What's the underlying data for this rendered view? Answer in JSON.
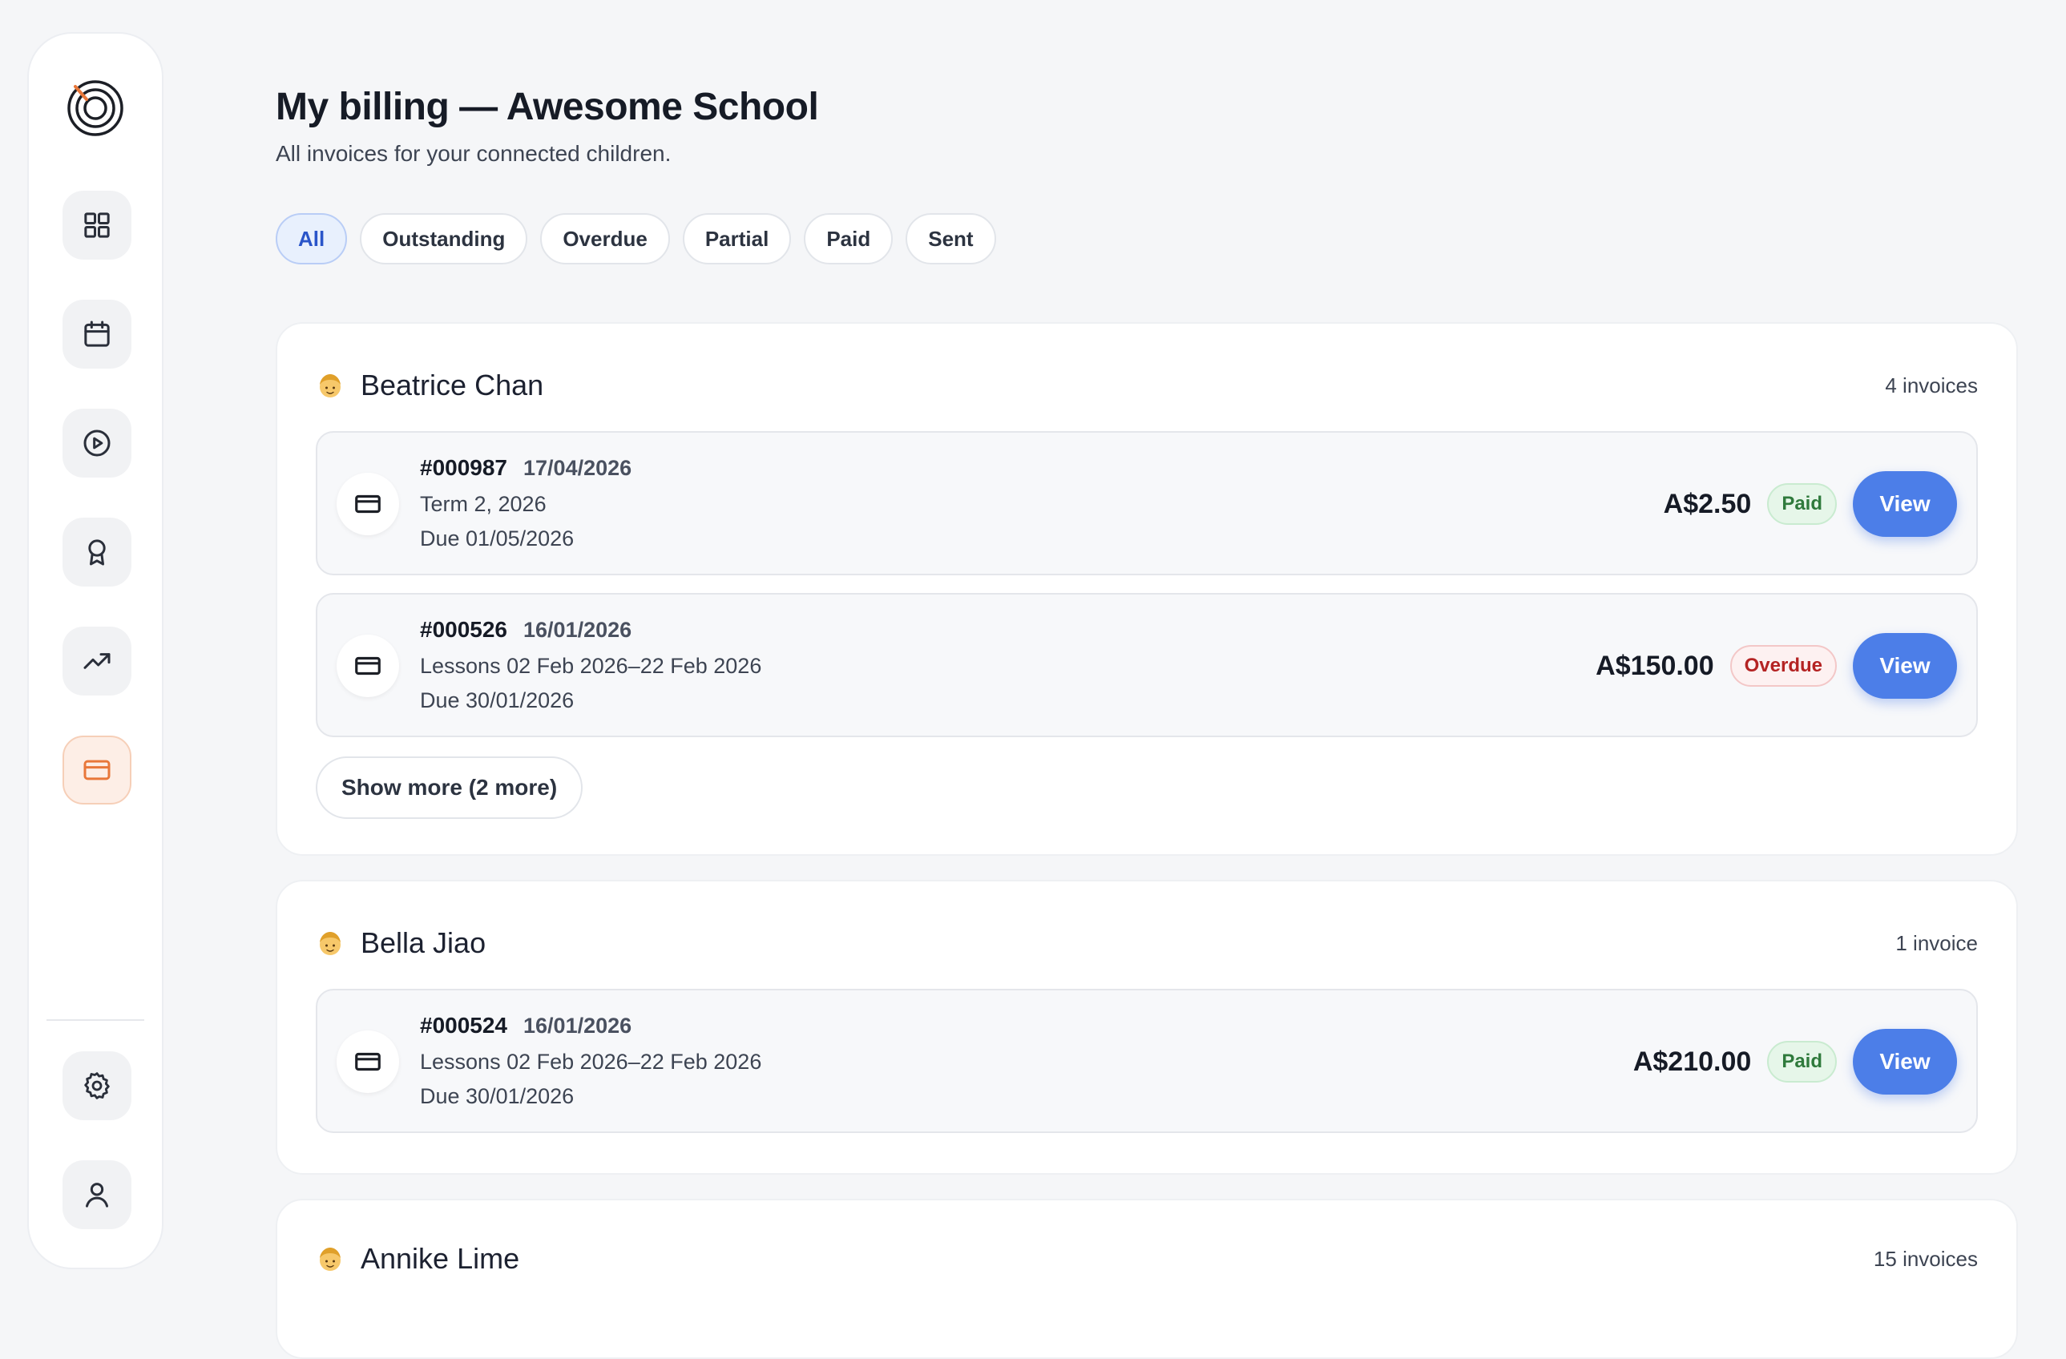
{
  "page": {
    "title": "My billing — Awesome School",
    "subtitle": "All invoices for your connected children."
  },
  "sidebar": {
    "items": [
      {
        "name": "dashboard",
        "icon": "grid-icon",
        "active": false
      },
      {
        "name": "calendar",
        "icon": "calendar-icon",
        "active": false
      },
      {
        "name": "lessons",
        "icon": "play-circle-icon",
        "active": false
      },
      {
        "name": "achievements",
        "icon": "award-icon",
        "active": false
      },
      {
        "name": "progress",
        "icon": "trending-up-icon",
        "active": false
      },
      {
        "name": "billing",
        "icon": "credit-card-icon",
        "active": true
      }
    ],
    "bottom": [
      {
        "name": "settings",
        "icon": "gear-icon"
      },
      {
        "name": "profile",
        "icon": "user-icon"
      }
    ],
    "accent": "#e8773a"
  },
  "filters": [
    {
      "label": "All",
      "active": true
    },
    {
      "label": "Outstanding",
      "active": false
    },
    {
      "label": "Overdue",
      "active": false
    },
    {
      "label": "Partial",
      "active": false
    },
    {
      "label": "Paid",
      "active": false
    },
    {
      "label": "Sent",
      "active": false
    }
  ],
  "children": [
    {
      "name": "Beatrice Chan",
      "count": "4 invoices",
      "invoices": [
        {
          "number": "#000987",
          "date": "17/04/2026",
          "description": "Term 2, 2026",
          "due": "Due 01/05/2026",
          "amount": "A$2.50",
          "status": "Paid",
          "action": "View"
        },
        {
          "number": "#000526",
          "date": "16/01/2026",
          "description": "Lessons 02 Feb 2026–22 Feb 2026",
          "due": "Due 30/01/2026",
          "amount": "A$150.00",
          "status": "Overdue",
          "action": "View"
        }
      ],
      "show_more": "Show more (2 more)"
    },
    {
      "name": "Bella Jiao",
      "count": "1 invoice",
      "invoices": [
        {
          "number": "#000524",
          "date": "16/01/2026",
          "description": "Lessons 02 Feb 2026–22 Feb 2026",
          "due": "Due 30/01/2026",
          "amount": "A$210.00",
          "status": "Paid",
          "action": "View"
        }
      ]
    },
    {
      "name": "Annike Lime",
      "count": "15 invoices",
      "invoices": []
    }
  ],
  "colors": {
    "primary_button": "#4c7ee8",
    "paid": "#2f7a3c",
    "overdue": "#b42323"
  }
}
